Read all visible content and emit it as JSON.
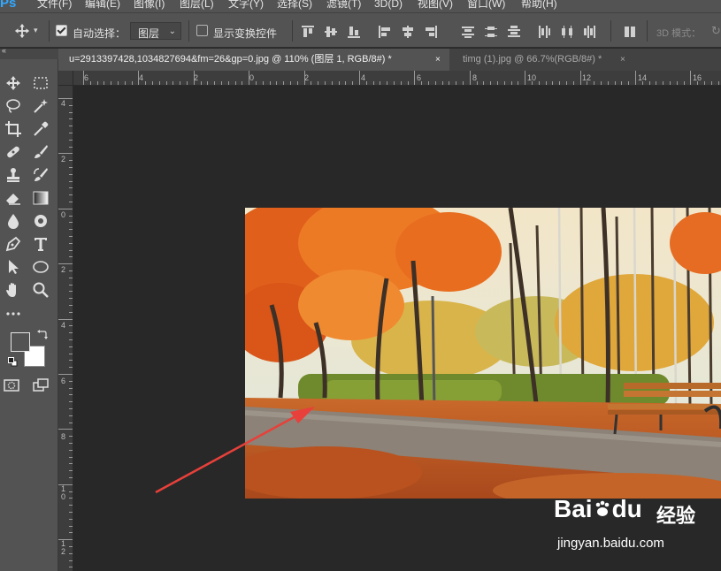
{
  "app": {
    "logo": "Ps"
  },
  "menu": {
    "items": [
      "文件(F)",
      "编辑(E)",
      "图像(I)",
      "图层(L)",
      "文字(Y)",
      "选择(S)",
      "滤镜(T)",
      "3D(D)",
      "视图(V)",
      "窗口(W)",
      "帮助(H)"
    ]
  },
  "options": {
    "auto_select_label": "自动选择：",
    "auto_select_checked": true,
    "auto_select_target": "图层",
    "show_transform_label": "显示变换控件",
    "show_transform_checked": false,
    "mode_3d_label": "3D 模式："
  },
  "tabs": [
    {
      "title": "u=2913397428,1034827694&fm=26&gp=0.jpg @ 110% (图层 1, RGB/8#) *",
      "close": "×",
      "active": true
    },
    {
      "title": "timg (1).jpg @ 66.7%(RGB/8#) *",
      "close": "×",
      "active": false
    }
  ],
  "ruler_top": [
    "6",
    "4",
    "2",
    "0",
    "2",
    "4",
    "6",
    "8",
    "10",
    "12",
    "14",
    "16"
  ],
  "ruler_left": [
    "4",
    "2",
    "0",
    "2",
    "4",
    "6",
    "8",
    "1 0",
    "1 2"
  ],
  "toolbox_grip": "«",
  "tools": [
    "move-tool-icon",
    "marquee-tool-icon",
    "lasso-tool-icon",
    "magic-wand-tool-icon",
    "crop-tool-icon",
    "eyedropper-tool-icon",
    "healing-brush-tool-icon",
    "brush-tool-icon",
    "clone-stamp-tool-icon",
    "history-brush-tool-icon",
    "eraser-tool-icon",
    "gradient-tool-icon",
    "blur-tool-icon",
    "dodge-tool-icon",
    "pen-tool-icon",
    "type-tool-icon",
    "path-selection-tool-icon",
    "ellipse-tool-icon",
    "hand-tool-icon",
    "zoom-tool-icon",
    "more-tools-icon",
    "quick-mask-icon",
    "screen-mode-icon"
  ],
  "colors": {
    "foreground": "#535353",
    "background": "#ffffff",
    "arrow": "#e8403a"
  },
  "watermark": {
    "brand": "Bai",
    "brand2": "du",
    "cn": "经验",
    "url": "jingyan.baidu.com"
  }
}
